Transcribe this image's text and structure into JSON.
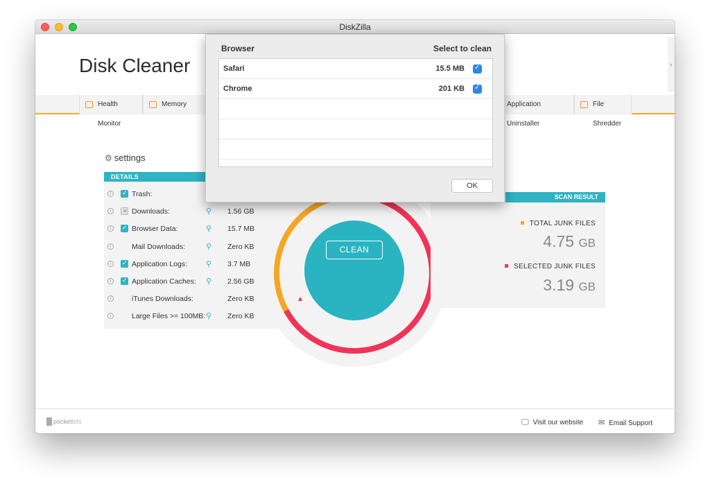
{
  "window": {
    "title": "DiskZilla"
  },
  "app": {
    "title": "Disk Cleaner"
  },
  "nav": {
    "items": [
      {
        "label": "Health Monitor"
      },
      {
        "label": "Memory Cleaner"
      },
      {
        "label": "Application Uninstaller"
      },
      {
        "label": "File Shredder"
      }
    ]
  },
  "settings": {
    "label": "settings"
  },
  "details": {
    "header": "DETAILS",
    "rows": [
      {
        "label": "Trash:",
        "size": "",
        "checkbox": "checked",
        "search": false
      },
      {
        "label": "Downloads:",
        "size": "1.56 GB",
        "checkbox": "excluded",
        "search": true
      },
      {
        "label": "Browser Data:",
        "size": "15.7 MB",
        "checkbox": "checked",
        "search": true
      },
      {
        "label": "Mail Downloads:",
        "size": "Zero KB",
        "checkbox": "none",
        "search": true
      },
      {
        "label": "Application Logs:",
        "size": "3.7 MB",
        "checkbox": "checked",
        "search": true
      },
      {
        "label": "Application Caches:",
        "size": "2.56 GB",
        "checkbox": "checked",
        "search": true
      },
      {
        "label": "iTunes Downloads:",
        "size": "Zero KB",
        "checkbox": "none",
        "search": false
      },
      {
        "label": "Large Files >= 100MB:",
        "size": "Zero KB",
        "checkbox": "none",
        "search": true
      }
    ]
  },
  "clean": {
    "label": "CLEAN",
    "selected_fraction": 0.67
  },
  "scan": {
    "header": "SCAN RESULT",
    "total_label": "TOTAL JUNK FILES",
    "total_value": "4.75",
    "total_unit": "GB",
    "selected_label": "SELECTED JUNK FILES",
    "selected_value": "3.19",
    "selected_unit": "GB"
  },
  "colors": {
    "accent": "#2fb3c3",
    "orange": "#f5a623",
    "red": "#f0335a",
    "checkbox_blue": "#2e86e6"
  },
  "footer": {
    "brand_a": "pocket",
    "brand_b": "bits",
    "visit": "Visit our website",
    "email": "Email Support"
  },
  "sheet": {
    "col_browser": "Browser",
    "col_select": "Select to clean",
    "rows": [
      {
        "name": "Safari",
        "size": "15.5 MB",
        "checked": true
      },
      {
        "name": "Chrome",
        "size": "201 KB",
        "checked": true
      }
    ],
    "ok": "OK"
  }
}
